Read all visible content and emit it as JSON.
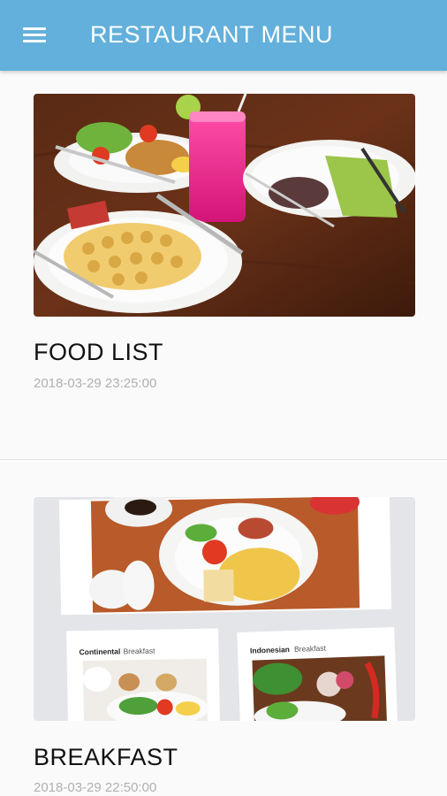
{
  "app_bar": {
    "title": "RESTAURANT MENU",
    "menu_icon": "hamburger-menu-icon",
    "background_color": "#62b0db"
  },
  "cards": [
    {
      "title": "FOOD LIST",
      "date": "2018-03-29 23:25:00",
      "image": "food-list-photo"
    },
    {
      "title": "BREAKFAST",
      "date": "2018-03-29 22:50:00",
      "image": "breakfast-photo",
      "image_labels": {
        "continental_strong": "Continental",
        "continental_light": "Breakfast",
        "indonesian_strong": "Indonesian",
        "indonesian_light": "Breakfast"
      }
    }
  ]
}
